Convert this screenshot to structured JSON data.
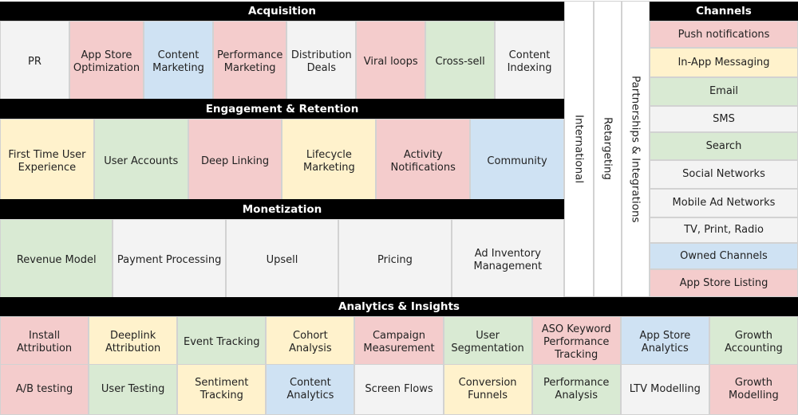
{
  "acquisition": {
    "title": "Acquisition",
    "items": [
      {
        "label": "PR",
        "color": "#f3f3f3"
      },
      {
        "label": "App Store Optimization",
        "color": "#f4cccc"
      },
      {
        "label": "Content Marketing",
        "color": "#cfe2f3"
      },
      {
        "label": "Performance Marketing",
        "color": "#f4cccc"
      },
      {
        "label": "Distribution Deals",
        "color": "#f3f3f3"
      },
      {
        "label": "Viral loops",
        "color": "#f4cccc"
      },
      {
        "label": "Cross-sell",
        "color": "#d9ead3"
      },
      {
        "label": "Content Indexing",
        "color": "#f3f3f3"
      }
    ]
  },
  "engagement": {
    "title": "Engagement & Retention",
    "items": [
      {
        "label": "First Time User Experience",
        "color": "#fff2cc"
      },
      {
        "label": "User Accounts",
        "color": "#d9ead3"
      },
      {
        "label": "Deep Linking",
        "color": "#f4cccc"
      },
      {
        "label": "Lifecycle Marketing",
        "color": "#fff2cc"
      },
      {
        "label": "Activity Notifications",
        "color": "#f4cccc"
      },
      {
        "label": "Community",
        "color": "#cfe2f3"
      }
    ]
  },
  "monetization": {
    "title": "Monetization",
    "items": [
      {
        "label": "Revenue Model",
        "color": "#d9ead3"
      },
      {
        "label": "Payment Processing",
        "color": "#f3f3f3"
      },
      {
        "label": "Upsell",
        "color": "#f3f3f3"
      },
      {
        "label": "Pricing",
        "color": "#f3f3f3"
      },
      {
        "label": "Ad Inventory Management",
        "color": "#f3f3f3"
      }
    ]
  },
  "verticals": [
    {
      "label": "International",
      "color": "#f3f3f3"
    },
    {
      "label": "Retargeting",
      "color": "#fff2cc"
    },
    {
      "label": "Partnerships & Integrations",
      "color": "#f3f3f3"
    }
  ],
  "channels": {
    "title": "Channels",
    "items": [
      {
        "label": "Push notifications",
        "color": "#f4cccc"
      },
      {
        "label": "In-App Messaging",
        "color": "#fff2cc"
      },
      {
        "label": "Email",
        "color": "#d9ead3"
      },
      {
        "label": "SMS",
        "color": "#f3f3f3"
      },
      {
        "label": "Search",
        "color": "#d9ead3"
      },
      {
        "label": "Social Networks",
        "color": "#f3f3f3"
      },
      {
        "label": "Mobile Ad Networks",
        "color": "#f3f3f3"
      },
      {
        "label": "TV, Print, Radio",
        "color": "#f3f3f3"
      },
      {
        "label": "Owned Channels",
        "color": "#cfe2f3"
      },
      {
        "label": "App Store Listing",
        "color": "#f4cccc"
      }
    ]
  },
  "analytics": {
    "title": "Analytics & Insights",
    "rows": [
      [
        {
          "label": "Install Attribution",
          "color": "#f4cccc"
        },
        {
          "label": "Deeplink Attribution",
          "color": "#fff2cc"
        },
        {
          "label": "Event Tracking",
          "color": "#d9ead3"
        },
        {
          "label": "Cohort Analysis",
          "color": "#fff2cc"
        },
        {
          "label": "Campaign Measurement",
          "color": "#f4cccc"
        },
        {
          "label": "User Segmentation",
          "color": "#d9ead3"
        },
        {
          "label": "ASO Keyword Performance Tracking",
          "color": "#f4cccc"
        },
        {
          "label": "App Store Analytics",
          "color": "#cfe2f3"
        },
        {
          "label": "Growth Accounting",
          "color": "#d9ead3"
        }
      ],
      [
        {
          "label": "A/B testing",
          "color": "#f4cccc"
        },
        {
          "label": "User Testing",
          "color": "#d9ead3"
        },
        {
          "label": "Sentiment Tracking",
          "color": "#fff2cc"
        },
        {
          "label": "Content Analytics",
          "color": "#cfe2f3"
        },
        {
          "label": "Screen Flows",
          "color": "#f3f3f3"
        },
        {
          "label": "Conversion Funnels",
          "color": "#fff2cc"
        },
        {
          "label": "Performance Analysis",
          "color": "#d9ead3"
        },
        {
          "label": "LTV Modelling",
          "color": "#f3f3f3"
        },
        {
          "label": "Growth Modelling",
          "color": "#f4cccc"
        }
      ]
    ]
  }
}
